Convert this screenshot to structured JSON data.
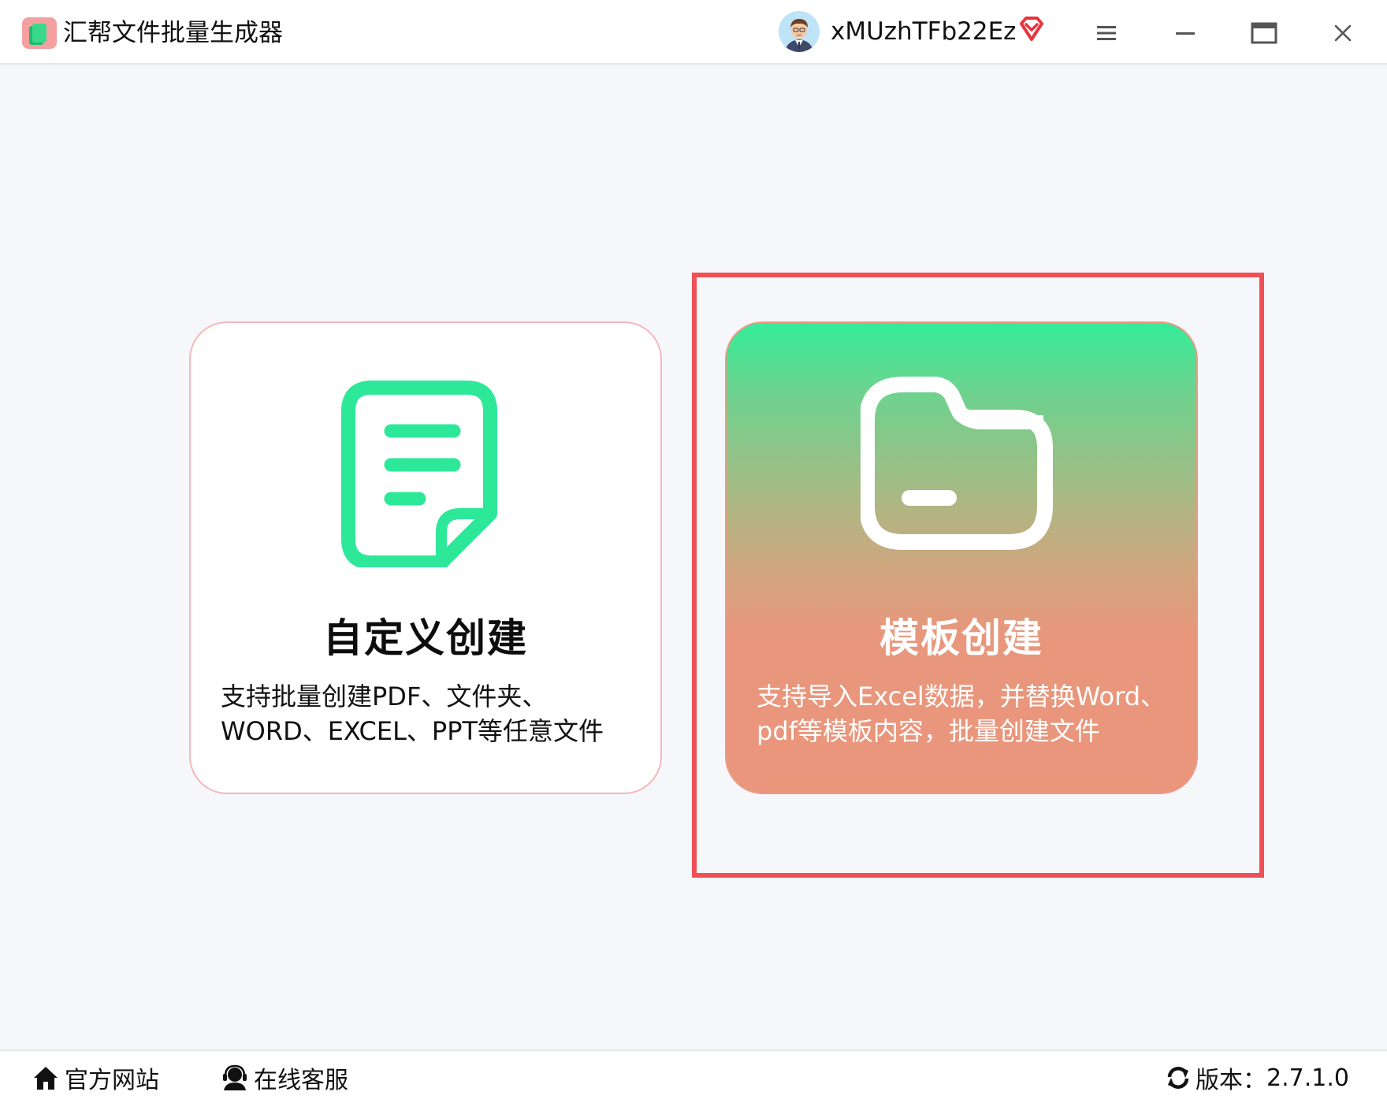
{
  "app": {
    "title": "汇帮文件批量生成器"
  },
  "user": {
    "name": "xMUzhTFb22Ez"
  },
  "icons": {
    "logo": "app-logo-icon",
    "avatar": "user-avatar",
    "vip": "vip-diamond-icon",
    "menu": "hamburger-menu-icon",
    "minimize": "minimize-icon",
    "maximize": "maximize-icon",
    "close": "close-icon",
    "custom_card": "document-icon",
    "template_card": "folder-icon",
    "website": "home-icon",
    "support": "headset-icon",
    "version": "refresh-icon"
  },
  "cards": {
    "custom": {
      "title": "自定义创建",
      "desc_line1": "支持批量创建PDF、文件夹、",
      "desc_line2": "WORD、EXCEL、PPT等任意文件"
    },
    "template": {
      "title": "模板创建",
      "desc_line1": "支持导入Excel数据，并替换Word、",
      "desc_line2": "pdf等模板内容，批量创建文件",
      "selected": true
    }
  },
  "footer": {
    "website_label": "官方网站",
    "support_label": "在线客服",
    "version_prefix": "版本：",
    "version_number": "2.7.1.0"
  },
  "colors": {
    "accent_green": "#2ee89a",
    "template_gradient_top": "#34ec98",
    "template_gradient_bottom": "#ea967c",
    "selection_border": "#ef4f55",
    "vip_red": "#e8343f"
  }
}
